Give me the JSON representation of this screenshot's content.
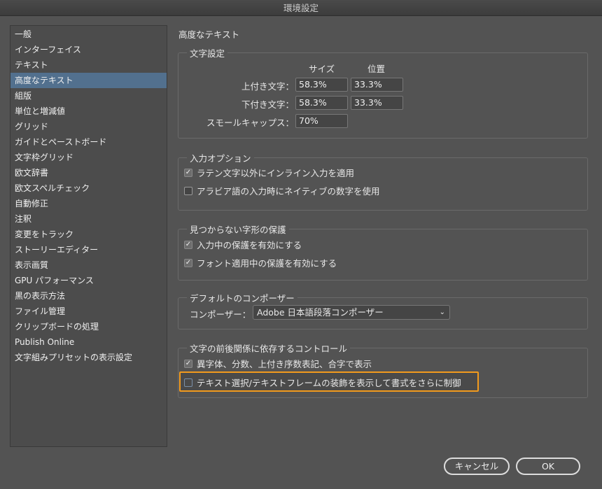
{
  "window": {
    "title": "環境設定"
  },
  "sidebar": {
    "items": [
      "一般",
      "インターフェイス",
      "テキスト",
      "高度なテキスト",
      "組版",
      "単位と増減値",
      "グリッド",
      "ガイドとペーストボード",
      "文字枠グリッド",
      "欧文辞書",
      "欧文スペルチェック",
      "自動修正",
      "注釈",
      "変更をトラック",
      "ストーリーエディター",
      "表示画質",
      "GPU パフォーマンス",
      "黒の表示方法",
      "ファイル管理",
      "クリップボードの処理",
      "Publish Online",
      "文字組みプリセットの表示設定"
    ],
    "selected": 3
  },
  "panel": {
    "title": "高度なテキスト"
  },
  "char_settings": {
    "title": "文字設定",
    "col_size": "サイズ",
    "col_position": "位置",
    "superscript_label": "上付き文字：",
    "superscript_size": "58.3%",
    "superscript_position": "33.3%",
    "subscript_label": "下付き文字：",
    "subscript_size": "58.3%",
    "subscript_position": "33.3%",
    "smallcaps_label": "スモールキャップス：",
    "smallcaps_size": "70%"
  },
  "input_options": {
    "title": "入力オプション",
    "opt1": "ラテン文字以外にインライン入力を適用",
    "opt1_checked": true,
    "opt2": "アラビア語の入力時にネイティブの数字を使用",
    "opt2_checked": false
  },
  "missing_glyph": {
    "title": "見つからない字形の保護",
    "opt1": "入力中の保護を有効にする",
    "opt1_checked": true,
    "opt2": "フォント適用中の保護を有効にする",
    "opt2_checked": true
  },
  "composer": {
    "title": "デフォルトのコンポーザー",
    "label": "コンポーザー：",
    "value": "Adobe 日本語段落コンポーザー"
  },
  "context": {
    "title": "文字の前後関係に依存するコントロール",
    "opt1": "異字体、分数、上付き序数表記、合字で表示",
    "opt1_checked": true,
    "opt2": "テキスト選択/テキストフレームの装飾を表示して書式をさらに制御",
    "opt2_checked": false
  },
  "buttons": {
    "cancel": "キャンセル",
    "ok": "OK"
  },
  "colors": {
    "highlight": "#f29a1d",
    "selection": "#52708e"
  },
  "check_glyph": "✓"
}
